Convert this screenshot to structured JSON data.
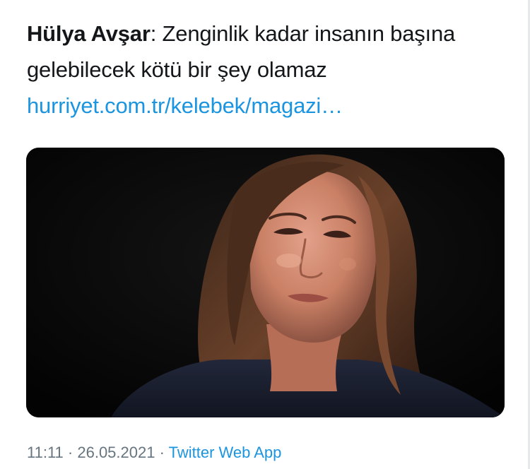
{
  "tweet": {
    "author_name": "Hülya Avşar",
    "separator": ":",
    "text": "Zenginlik kadar insanın başına gelebilecek kötü bir şey olamaz",
    "link_text": "hurriyet.com.tr/kelebek/magazi…"
  },
  "media": {
    "description_icon": "photo"
  },
  "meta": {
    "time": "11:11",
    "dot1": " · ",
    "date": "26.05.2021",
    "dot2": " · ",
    "source": "Twitter Web App"
  },
  "colors": {
    "text": "#14171a",
    "link": "#1b95e0",
    "meta": "#66757f",
    "background": "#ffffff"
  }
}
